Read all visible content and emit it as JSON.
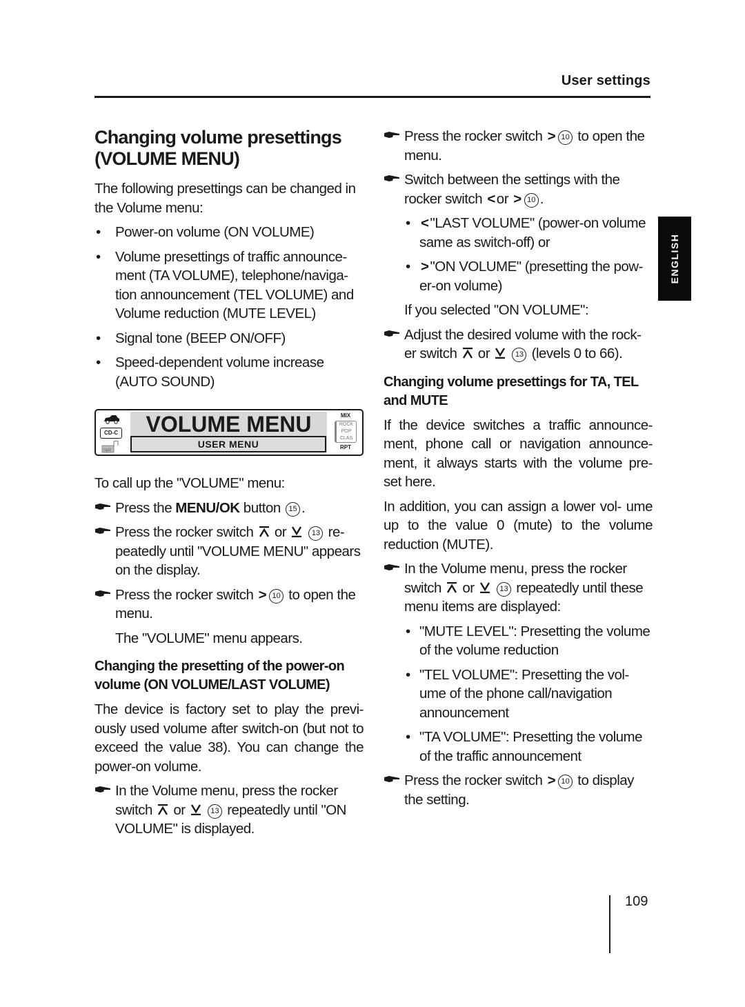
{
  "header": {
    "section_title": "User settings"
  },
  "side_tab": {
    "label": "ENGLISH"
  },
  "page_number": "109",
  "left": {
    "title_line1": "Changing volume presettings",
    "title_line2": "(VOLUME MENU)",
    "intro": "The following presettings can be changed in the Volume menu:",
    "bullets": [
      "Power-on volume (ON VOLUME)",
      "Volume presettings of traffic announce- ment (TA VOLUME), telephone/naviga- tion announcement (TEL VOLUME) and Volume reduction (MUTE LEVEL)",
      "Signal tone (BEEP ON/OFF)",
      "Speed-dependent volume increase (AUTO SOUND)"
    ],
    "display": {
      "main_text": "VOLUME MENU",
      "sub_text": "USER MENU",
      "cdc_label": "CD-C",
      "right_top": "MIX",
      "eq_options": [
        "ROCK",
        "POP",
        "CLAS"
      ],
      "right_bottom": "RPT",
      "icons": [
        "traffic-cars-icon",
        "cd-changer-icon",
        "mp3-icon"
      ]
    },
    "call_up_intro": "To call up the \"VOLUME\" menu:",
    "steps": [
      {
        "pre": "Press the ",
        "bold": "MENU/OK",
        "post": " button",
        "ref": "15",
        "end": "."
      },
      {
        "pre": "Press the rocker switch",
        "mid": "or",
        "ref": "13",
        "post": " re- peatedly until \"VOLUME MENU\" appears on the display."
      },
      {
        "pre": "Press the rocker switch",
        "ref": "10",
        "post": " to open the menu."
      }
    ],
    "menu_appears": "The \"VOLUME\" menu appears.",
    "subheading": "Changing the presetting of the power-on volume (ON VOLUME/LAST VOLUME)",
    "factory_text": "The device is factory set to play the previ- ously used volume after switch-on (but not to exceed the value 38). You can change the power-on volume.",
    "step_on_volume": {
      "pre": "In the Volume menu, press the rocker switch",
      "mid": "or",
      "ref": "13",
      "post": " repeatedly until \"ON VOLUME\" is displayed."
    }
  },
  "right": {
    "step_open": {
      "pre": "Press the rocker switch",
      "ref": "10",
      "post": " to open the menu."
    },
    "step_switch": {
      "pre": "Switch between the settings with the rocker switch",
      "mid": "or",
      "ref": "10",
      "end": "."
    },
    "sub_bullets": [
      "\"LAST VOLUME\" (power-on volume same as switch-off) or",
      "\"ON VOLUME\" (presetting the pow- er-on volume)"
    ],
    "if_selected": "If you selected \"ON VOLUME\":",
    "step_adjust": {
      "pre": "Adjust the desired volume with the rock- er switch",
      "mid": "or",
      "ref": "13",
      "post": " (levels 0 to 66)."
    },
    "subheading": "Changing volume presettings for TA, TEL and MUTE",
    "para1": "If the device switches a traffic announce- ment, phone call or navigation announce- ment, it always starts with the volume pre- set here.",
    "para2": "In addition, you can assign a lower vol- ume up to the value 0 (mute) to the volume reduction (MUTE).",
    "step_items": {
      "pre": "In the Volume menu, press the rocker switch",
      "mid": "or",
      "ref": "13",
      "post": " repeatedly until these menu items are displayed:"
    },
    "items": [
      "\"MUTE LEVEL\": Presetting the volume of the volume reduction",
      "\"TEL VOLUME\": Presetting the vol- ume of the phone call/navigation announcement",
      "\"TA VOLUME\": Presetting the volume of the traffic announcement"
    ],
    "step_display": {
      "pre": "Press the rocker switch",
      "ref": "10",
      "post": " to display the setting."
    }
  }
}
